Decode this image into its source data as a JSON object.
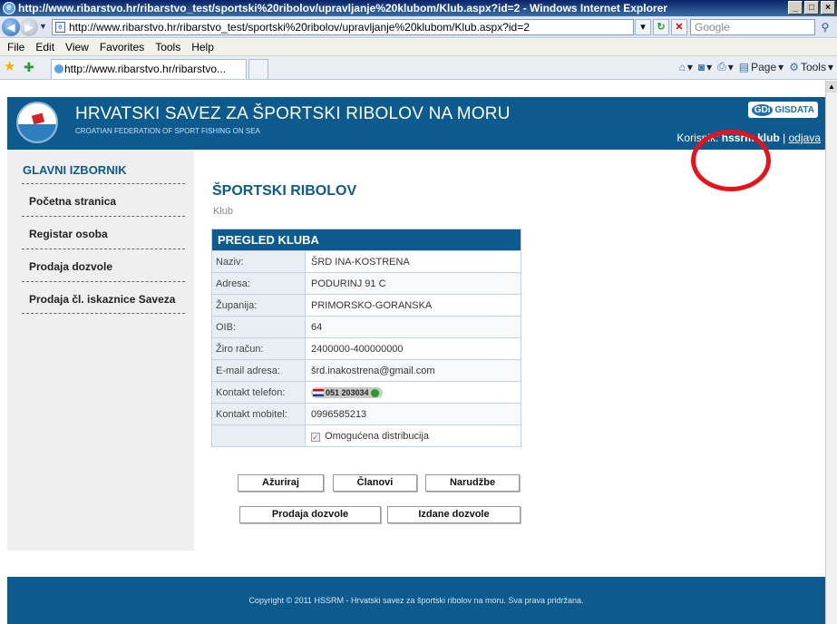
{
  "browser": {
    "title": "http://www.ribarstvo.hr/ribarstvo_test/sportski%20ribolov/upravljanje%20klubom/Klub.aspx?id=2 - Windows Internet Explorer",
    "url": "http://www.ribarstvo.hr/ribarstvo_test/sportski%20ribolov/upravljanje%20klubom/Klub.aspx?id=2",
    "search_placeholder": "Google",
    "menu": [
      "File",
      "Edit",
      "View",
      "Favorites",
      "Tools",
      "Help"
    ],
    "tab_title": "http://www.ribarstvo.hr/ribarstvo...",
    "commands": {
      "page": "Page",
      "tools": "Tools"
    }
  },
  "site": {
    "title": "HRVATSKI SAVEZ ZA ŠPORTSKI RIBOLOV NA MORU",
    "subtitle": "CROATIAN FEDERATION OF SPORT FISHING ON SEA",
    "partner_logo": {
      "part1": "GDi",
      "part2": "GISDATA"
    },
    "user_label": "Korisnik:",
    "username": "hssrm.klub",
    "separator": "|",
    "logout": "odjava"
  },
  "sidebar": {
    "title": "GLAVNI IZBORNIK",
    "items": [
      {
        "label": "Početna stranica"
      },
      {
        "label": "Registar osoba"
      },
      {
        "label": "Prodaja dozvole"
      },
      {
        "label": "Prodaja čl. iskaznice Saveza"
      }
    ]
  },
  "main": {
    "title": "ŠPORTSKI RIBOLOV",
    "breadcrumb": "Klub",
    "table_title": "PREGLED KLUBA",
    "rows": [
      {
        "label": "Naziv:",
        "value": "ŠRD INA-KOSTRENA"
      },
      {
        "label": "Adresa:",
        "value": "PODURINJ 91 C"
      },
      {
        "label": "Županija:",
        "value": "PRIMORSKO-GORANSKA"
      },
      {
        "label": "OIB:",
        "value": "64"
      },
      {
        "label": "Žiro račun:",
        "value": "2400000-400000000"
      },
      {
        "label": "E-mail adresa:",
        "value": "šrd.inakostrena@gmail.com"
      },
      {
        "label": "Kontakt telefon:",
        "value": "051 203034"
      },
      {
        "label": "Kontakt mobitel:",
        "value": "0996585213"
      }
    ],
    "distribution": {
      "label": "Omogućena distribucija",
      "checked": true
    },
    "buttons": {
      "update": "Ažuriraj",
      "members": "Članovi",
      "orders": "Narudžbe",
      "sell_permits": "Prodaja dozvole",
      "issued_permits": "Izdane dozvole"
    }
  },
  "footer": {
    "text": "Copyright © 2011 HSSRM - Hrvatski savez za športski ribolov na moru. Sva prava pridržana."
  },
  "colors": {
    "brand_blue": "#0c5a8e",
    "annotation_red": "#e8121a"
  }
}
